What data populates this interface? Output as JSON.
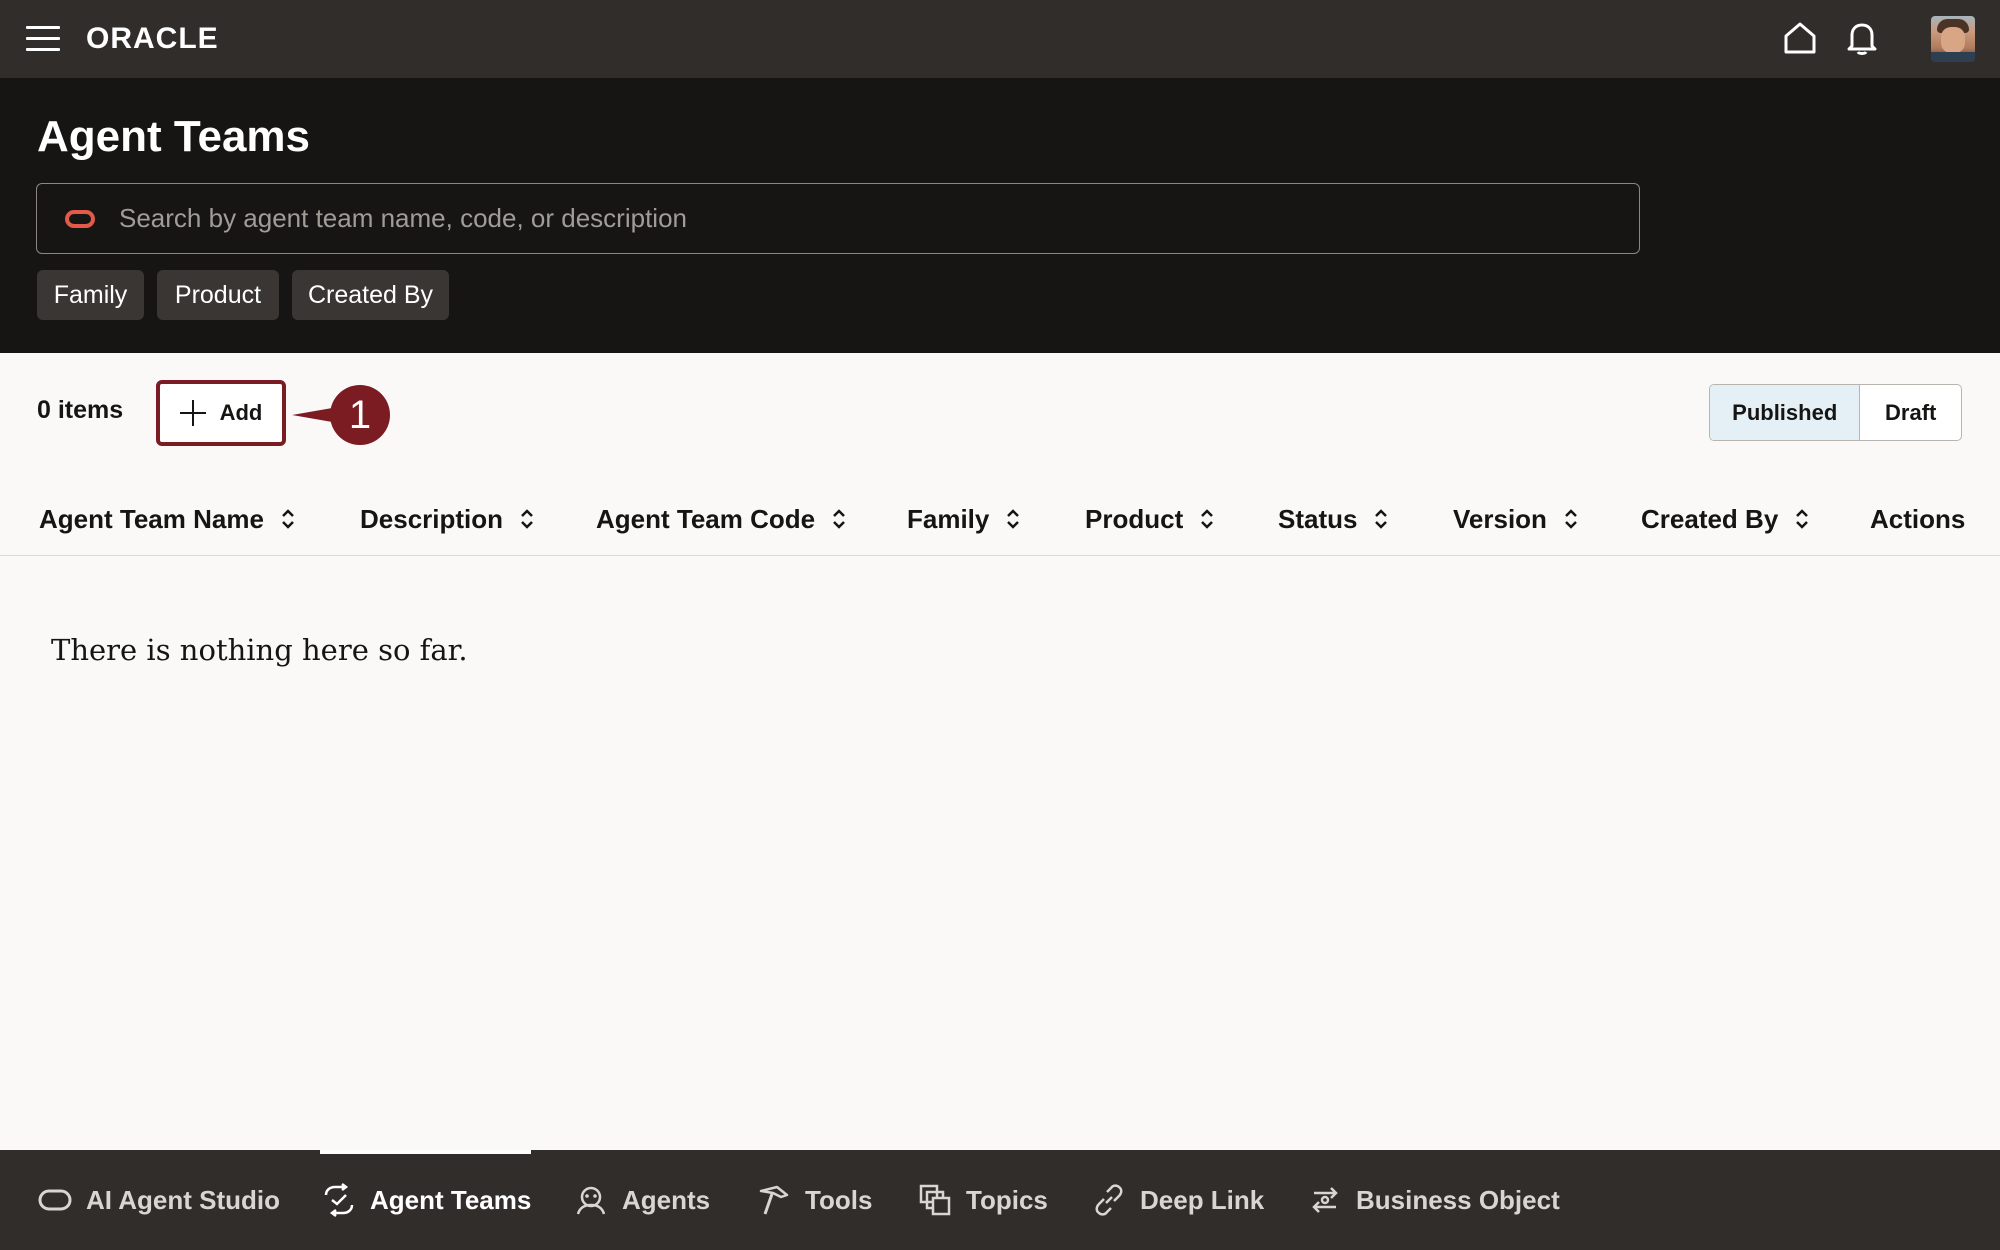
{
  "topbar": {
    "logo_text": "ORACLE",
    "menu_icon": "hamburger-menu-icon",
    "home_icon": "home-icon",
    "notifications_icon": "bell-icon",
    "avatar": "user-avatar"
  },
  "header": {
    "title": "Agent Teams",
    "search_placeholder": "Search by agent team name, code, or description",
    "search_value": "",
    "filters": [
      "Family",
      "Product",
      "Created By"
    ]
  },
  "toolbar": {
    "items_count": "0 items",
    "add_label": "Add",
    "callout_number": "1",
    "view_toggle": {
      "published": "Published",
      "draft": "Draft",
      "selected": "Published"
    }
  },
  "table": {
    "columns": [
      "Agent Team Name",
      "Description",
      "Agent Team Code",
      "Family",
      "Product",
      "Status",
      "Version",
      "Created By",
      "Actions"
    ],
    "rows": [],
    "empty_message": "There is nothing here so far."
  },
  "bottom_nav": {
    "items": [
      "AI Agent Studio",
      "Agent Teams",
      "Agents",
      "Tools",
      "Topics",
      "Deep Link",
      "Business Object"
    ],
    "active": "Agent Teams"
  },
  "colors": {
    "topbar_bg": "#312d2a",
    "header_bg": "#161513",
    "callout": "#7a1c22",
    "oracle_red": "#e25a48",
    "selected_toggle": "#e4f0f6"
  }
}
